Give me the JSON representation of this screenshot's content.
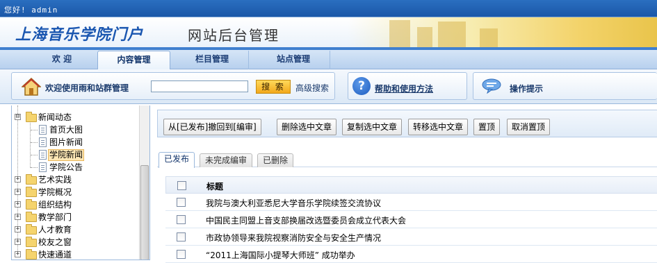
{
  "topbar": {
    "greeting": "您好! admin"
  },
  "header": {
    "logo": "上海音乐学院门户",
    "subtitle": "网站后台管理"
  },
  "nav": {
    "tabs": [
      {
        "label": "欢 迎"
      },
      {
        "label": "内容管理"
      },
      {
        "label": "栏目管理"
      },
      {
        "label": "站点管理"
      }
    ],
    "active_index": 1
  },
  "toolbar": {
    "welcome": "欢迎使用雨和站群管理",
    "search_value": "",
    "search_button": "搜 索",
    "advanced_search": "高级搜索",
    "help_icon_glyph": "?",
    "help": "帮助和使用方法",
    "tips": "操作提示"
  },
  "tree": {
    "items": [
      {
        "label": "新闻动态",
        "type": "folder",
        "expander": "⊟"
      },
      {
        "label": "首页大图",
        "type": "doc"
      },
      {
        "label": "图片新闻",
        "type": "doc"
      },
      {
        "label": "学院新闻",
        "type": "doc",
        "selected": true
      },
      {
        "label": "学院公告",
        "type": "doc"
      },
      {
        "label": "艺术实践",
        "type": "folder",
        "expander": "+"
      },
      {
        "label": "学院概况",
        "type": "folder",
        "expander": "+"
      },
      {
        "label": "组织结构",
        "type": "folder",
        "expander": "+"
      },
      {
        "label": "教学部门",
        "type": "folder",
        "expander": "+"
      },
      {
        "label": "人才教育",
        "type": "folder",
        "expander": "+"
      },
      {
        "label": "校友之窗",
        "type": "folder",
        "expander": "+"
      },
      {
        "label": "快速通道",
        "type": "folder",
        "expander": "+"
      }
    ]
  },
  "actions": {
    "buttons": [
      {
        "label": "从[已发布]撤回到[编审]"
      },
      {
        "label": "删除选中文章"
      },
      {
        "label": "复制选中文章"
      },
      {
        "label": "转移选中文章"
      },
      {
        "label": "置顶"
      },
      {
        "label": "取消置顶"
      }
    ]
  },
  "subtabs": [
    {
      "label": "已发布"
    },
    {
      "label": "未完成编审"
    },
    {
      "label": "已删除"
    }
  ],
  "table": {
    "header": "标题",
    "rows": [
      "我院与澳大利亚悉尼大学音乐学院续签交流协议",
      "中国民主同盟上音支部换届改选暨委员会成立代表大会",
      "市政协领导来我院视察消防安全与安全生产情况",
      "“2011上海国际小提琴大师班” 成功举办"
    ]
  },
  "colors": {
    "accent": "#1a56b0",
    "nav_bg": "#b7d0ee",
    "search_button": "#f2a81c"
  }
}
